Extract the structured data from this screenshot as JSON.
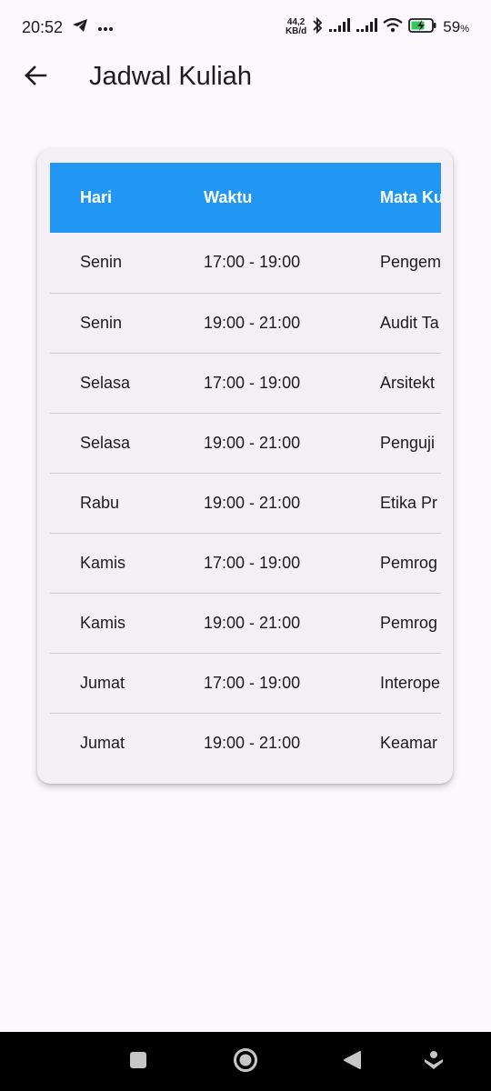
{
  "status_bar": {
    "time": "20:52",
    "net_speed_value": "44,2",
    "net_speed_unit": "KB/d",
    "battery_percent": "59",
    "battery_unit": "%"
  },
  "app_bar": {
    "title": "Jadwal Kuliah"
  },
  "table": {
    "header_color": "#2196f3",
    "columns": [
      "Hari",
      "Waktu",
      "Mata Ku"
    ],
    "rows": [
      [
        "Senin",
        "17:00 - 19:00",
        "Pengem"
      ],
      [
        "Senin",
        "19:00 - 21:00",
        "Audit Ta"
      ],
      [
        "Selasa",
        "17:00 - 19:00",
        "Arsitekt"
      ],
      [
        "Selasa",
        "19:00 - 21:00",
        "Penguji"
      ],
      [
        "Rabu",
        "19:00 - 21:00",
        "Etika Pr"
      ],
      [
        "Kamis",
        "17:00 - 19:00",
        "Pemrog"
      ],
      [
        "Kamis",
        "19:00 - 21:00",
        "Pemrog"
      ],
      [
        "Jumat",
        "17:00 - 19:00",
        "Interope"
      ],
      [
        "Jumat",
        "19:00 - 21:00",
        "Keamar"
      ]
    ]
  },
  "icons": {
    "status_left": [
      "telegram-icon",
      "more-dots-icon"
    ],
    "status_right": [
      "bluetooth-icon",
      "signal-icon",
      "signal-icon",
      "wifi-icon",
      "battery-charging-icon"
    ],
    "app_bar": [
      "back-arrow-icon"
    ],
    "nav": [
      "recents-square-icon",
      "home-circle-icon",
      "back-triangle-icon",
      "assistant-icon"
    ]
  }
}
